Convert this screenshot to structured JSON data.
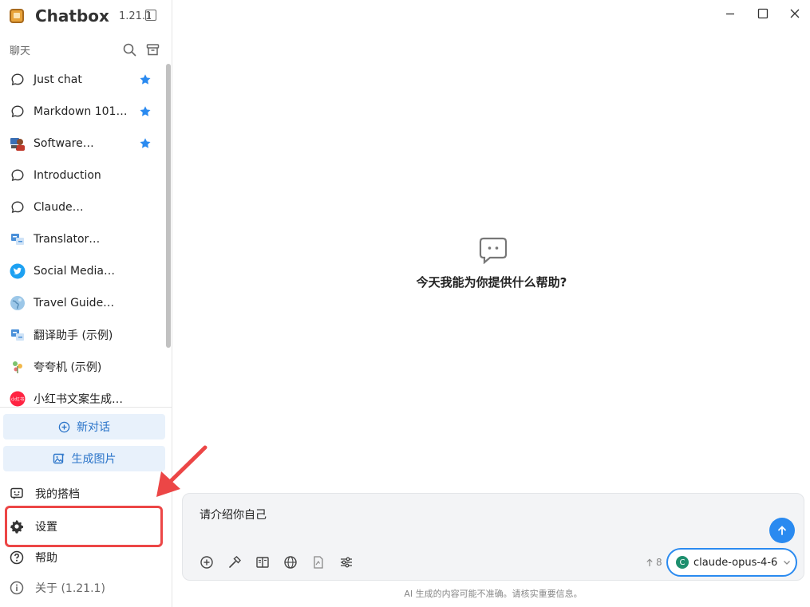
{
  "app": {
    "name": "Chatbox",
    "version": "1.21.1"
  },
  "sidebar": {
    "section_label": "聊天",
    "chats": [
      {
        "title": "Just chat",
        "icon": "chat-bubble-icon",
        "starred": true
      },
      {
        "title": "Markdown 101…",
        "icon": "chat-bubble-icon",
        "starred": true
      },
      {
        "title": "Software…",
        "icon": "developer-avatar-icon",
        "starred": true
      },
      {
        "title": "Introduction",
        "icon": "chat-bubble-icon",
        "starred": false
      },
      {
        "title": "Claude…",
        "icon": "chat-bubble-icon",
        "starred": false
      },
      {
        "title": "Translator…",
        "icon": "translator-avatar-icon",
        "starred": false
      },
      {
        "title": "Social Media…",
        "icon": "twitter-bird-icon",
        "starred": false
      },
      {
        "title": "Travel Guide…",
        "icon": "globe-avatar-icon",
        "starred": false
      },
      {
        "title": "翻译助手 (示例)",
        "icon": "translator-avatar-icon",
        "starred": false
      },
      {
        "title": "夸夸机 (示例)",
        "icon": "plant-avatar-icon",
        "starred": false
      },
      {
        "title": "小红书文案生成…",
        "icon": "xiaohongshu-avatar-icon",
        "starred": false
      }
    ],
    "new_chat_label": "新对话",
    "generate_image_label": "生成图片",
    "my_partners_label": "我的搭档",
    "settings_label": "设置",
    "help_label": "帮助",
    "about_label": "关于 (1.21.1)",
    "avatar_badge_text": "小红书"
  },
  "main": {
    "empty_prompt": "今天我能为你提供什么帮助?",
    "input_value": "请介绍你自己",
    "token_count": "8",
    "model_name": "claude-opus-4-6",
    "model_initial": "C",
    "disclaimer": "AI 生成的内容可能不准确。请核实重要信息。"
  },
  "colors": {
    "accent": "#2a8af0",
    "highlight": "#ec4646",
    "button_bg": "#e8f1fb",
    "button_text": "#2a74c9",
    "star": "#2a8af0"
  }
}
